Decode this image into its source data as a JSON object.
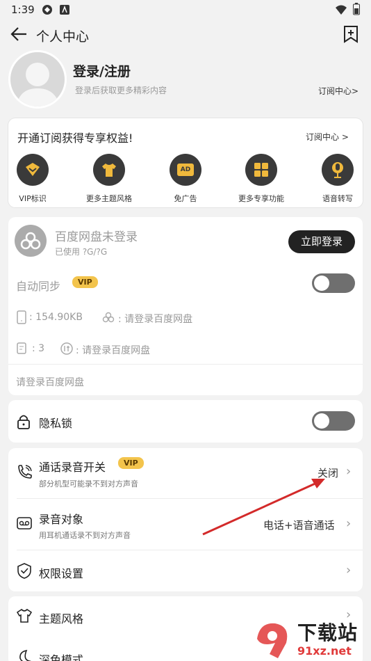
{
  "status": {
    "time": "1:39"
  },
  "header": {
    "title": "个人中心"
  },
  "profile": {
    "name": "登录/注册",
    "subtitle": "登录后获取更多精彩内容",
    "subscribe_link": "订阅中心>"
  },
  "promo": {
    "title": "开通订阅获得专享权益!",
    "link": "订阅中心 >",
    "features": [
      {
        "label": "VIP标识",
        "icon": "vip-badge-icon"
      },
      {
        "label": "更多主题风格",
        "icon": "shirt-icon"
      },
      {
        "label": "免广告",
        "icon": "ad-icon",
        "glyph": "AD"
      },
      {
        "label": "更多专享功能",
        "icon": "grid-icon"
      },
      {
        "label": "语音转写",
        "icon": "microphone-icon"
      }
    ]
  },
  "cloud": {
    "title": "百度网盘未登录",
    "usage": "已使用 ?G/?G",
    "login_button": "立即登录",
    "auto_sync": "自动同步",
    "vip": "VIP",
    "local_size": ": 154.90KB",
    "cloud_size": ": 请登录百度网盘",
    "local_count": ": 3",
    "cloud_count": ": 请登录百度网盘",
    "hint": "请登录百度网盘"
  },
  "privacy": {
    "label": "隐私锁"
  },
  "recording": {
    "call_title": "通话录音开关",
    "vip": "VIP",
    "call_sub": "部分机型可能录不到对方声音",
    "call_value": "关闭",
    "target_title": "录音对象",
    "target_sub": "用耳机通话录不到对方声音",
    "target_value": "电话+语音通话",
    "permission_title": "权限设置"
  },
  "theme": {
    "label": "主题风格",
    "dark_label": "深色模式"
  },
  "watermark": {
    "brand": "下载站",
    "domain": "91xz.net"
  }
}
